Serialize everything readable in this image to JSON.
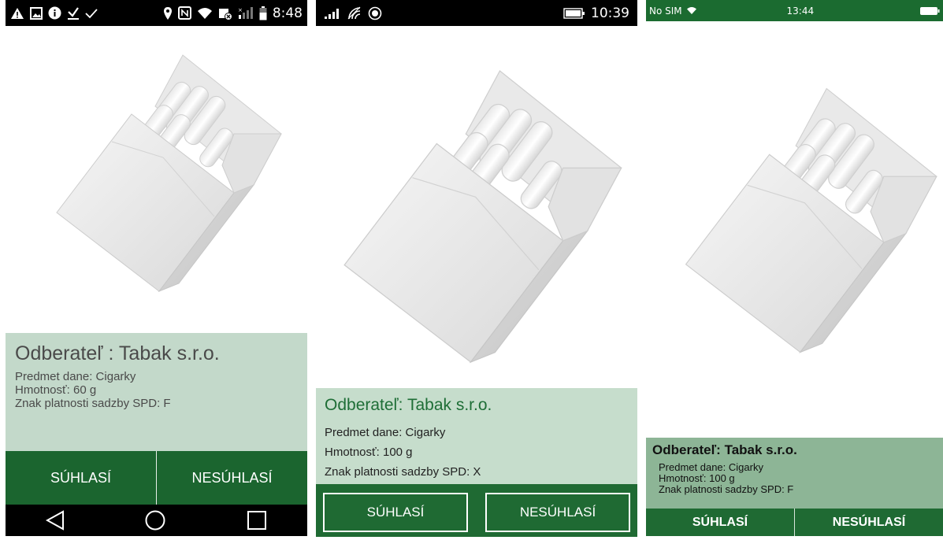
{
  "screens": [
    {
      "status_bar": {
        "time": "8:48"
      },
      "info": {
        "title": "Odberateľ : Tabak s.r.o.",
        "subject": "Predmet dane: Cigarky",
        "weight": "Hmotnosť: 60 g",
        "rate": "Znak platnosti sadzby SPD: F"
      },
      "buttons": {
        "agree": "SÚHLASÍ",
        "disagree": "NESÚHLASÍ"
      }
    },
    {
      "status_bar": {
        "time": "10:39"
      },
      "info": {
        "title": "Odberateľ: Tabak s.r.o.",
        "subject": "Predmet dane: Cigarky",
        "weight": "Hmotnosť: 100 g",
        "rate": "Znak platnosti sadzby SPD: X"
      },
      "buttons": {
        "agree": "SÚHLASÍ",
        "disagree": "NESÚHLASÍ"
      }
    },
    {
      "status_bar": {
        "carrier": "No SIM",
        "time": "13:44"
      },
      "info": {
        "title": "Odberateľ: Tabak s.r.o.",
        "subject": "Predmet dane: Cigarky",
        "weight": "Hmotnosť: 100 g",
        "rate": "Znak platnosti sadzby SPD: F"
      },
      "buttons": {
        "agree": "SÚHLASÍ",
        "disagree": "NESÚHLASÍ"
      }
    }
  ],
  "icons": {
    "android_status": [
      "warning-icon",
      "image-icon",
      "info-icon",
      "download-done-icon",
      "check-icon",
      "location-icon",
      "nfc-icon",
      "wifi-icon",
      "battery-saver-icon",
      "signal-icon",
      "battery-icon"
    ],
    "windows_status": [
      "signal-icon",
      "wifi-icon",
      "location-icon",
      "battery-icon"
    ],
    "ios_status": [
      "wifi-icon",
      "battery-icon"
    ],
    "android_nav": [
      "back-icon",
      "home-icon",
      "recents-icon"
    ]
  },
  "colors": {
    "accent_green": "#1b652f",
    "panel_green_light": "#c3d9ca",
    "panel_green_ios": "#8db596"
  }
}
